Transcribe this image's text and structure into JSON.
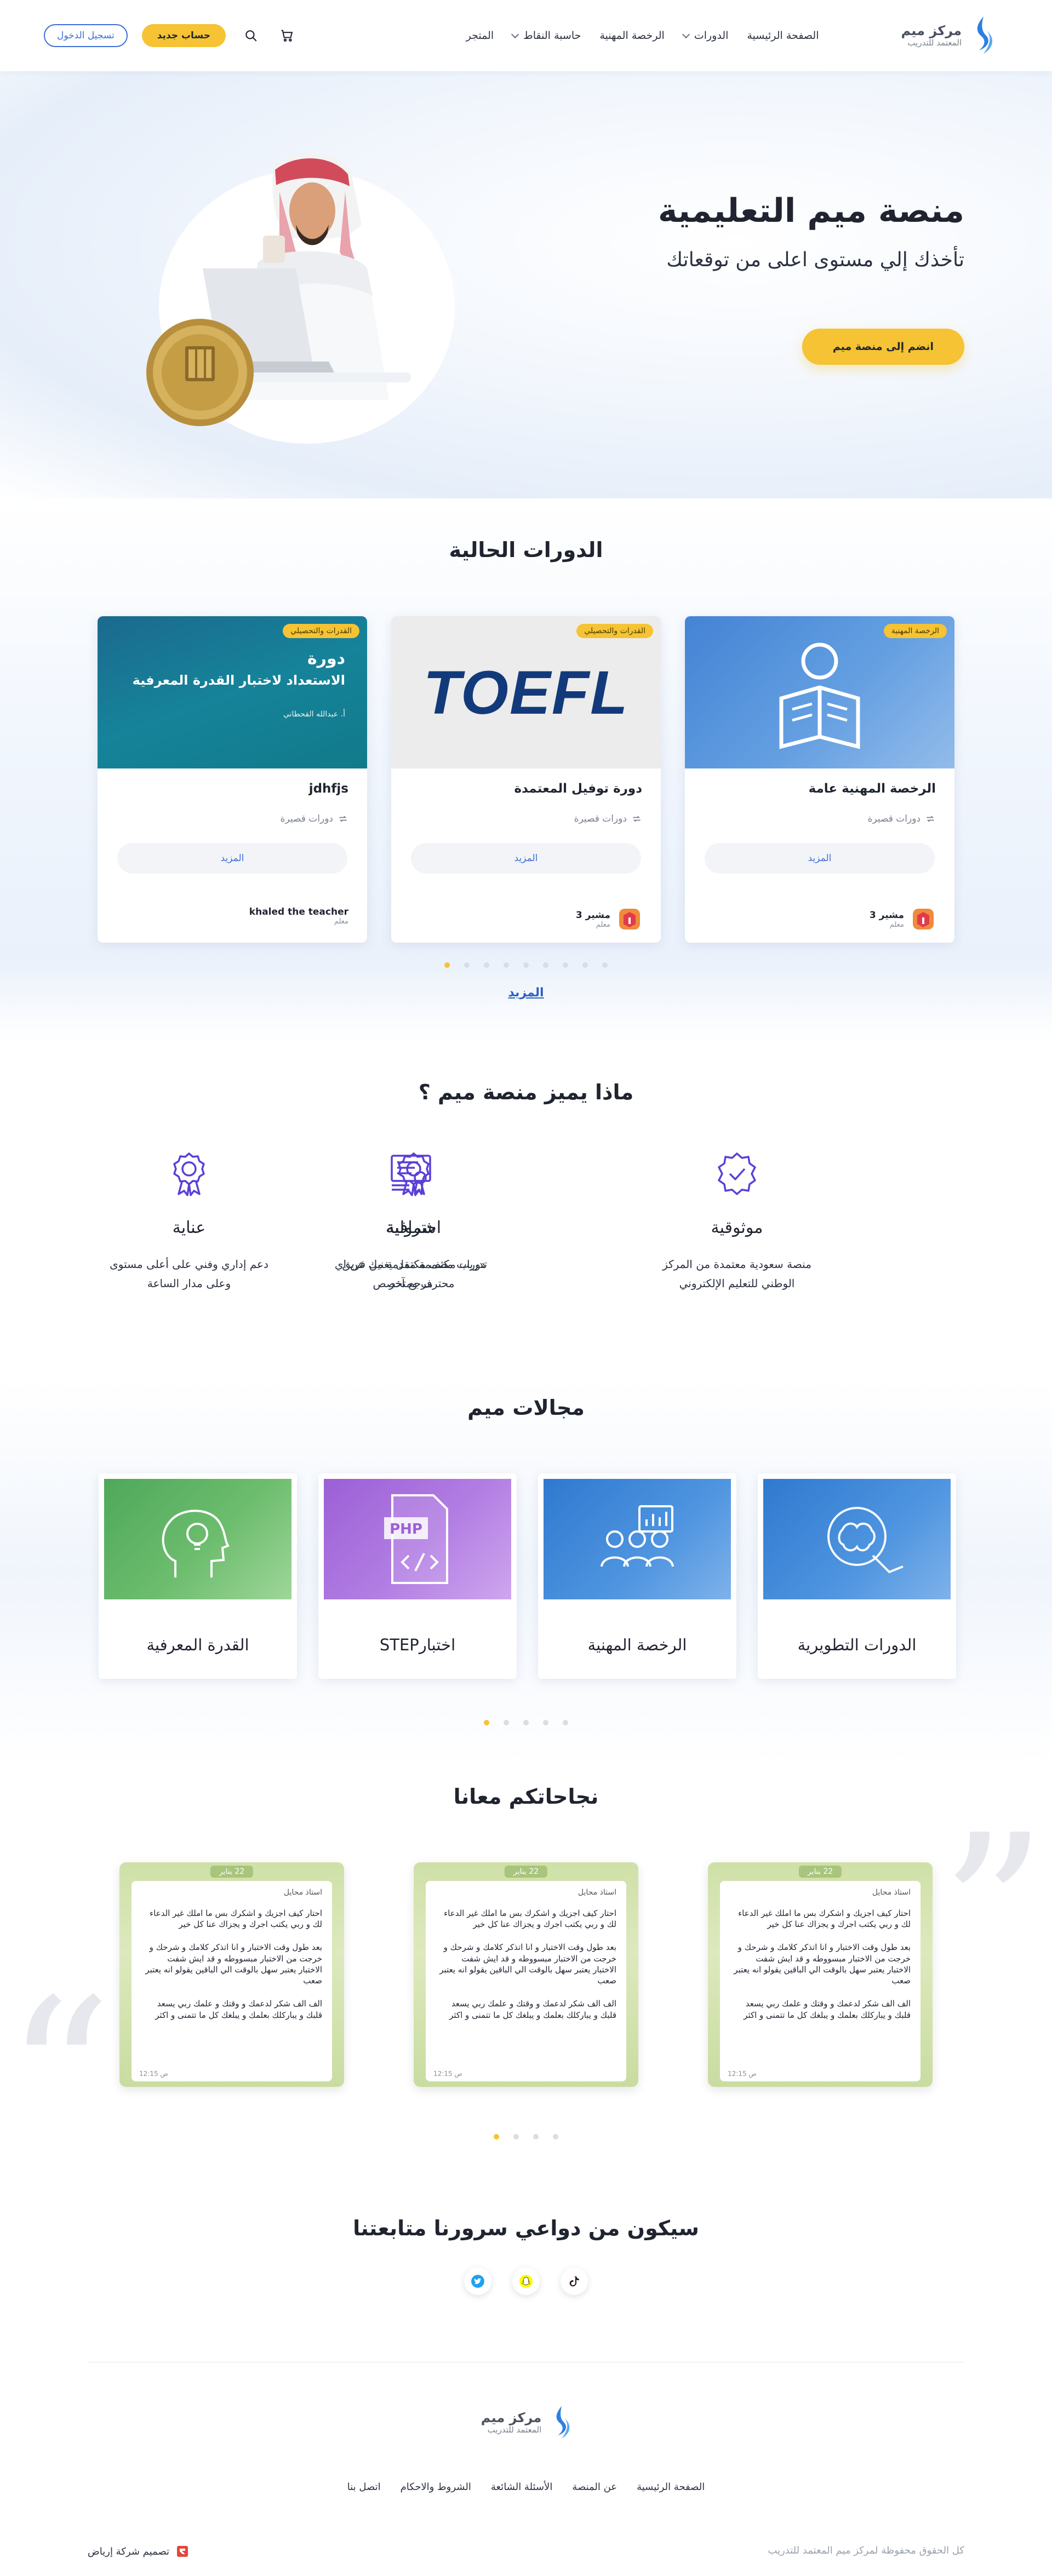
{
  "header": {
    "logo_title": "مركز ميم",
    "logo_subtitle": "المعتمد للتدريب",
    "nav": [
      {
        "label": "الصفحة الرئيسية",
        "has_dropdown": false
      },
      {
        "label": "الدورات",
        "has_dropdown": true
      },
      {
        "label": "الرخصة المهنية",
        "has_dropdown": false
      },
      {
        "label": "حاسبة النقاط",
        "has_dropdown": true
      },
      {
        "label": "المتجر",
        "has_dropdown": false
      }
    ],
    "new_account": "حساب جديد",
    "login": "تسجيل الدخول"
  },
  "hero": {
    "title": "منصة ميم التعليمية",
    "subtitle": "تأخذك إلي مستوى اعلى من توقعاتك",
    "cta": "انضم إلى منصة ميم"
  },
  "courses": {
    "title": "الدورات الحالية",
    "more_label": "المزيد",
    "view_all": "المزيد",
    "items": [
      {
        "badge": "الرخصة المهنية",
        "title": "الرخصة المهنية عامة",
        "meta": "دورات قصيرة",
        "teacher": "مشير 3",
        "role": "معلم"
      },
      {
        "badge": "القدرات والتحصيلي",
        "title": "دورة توفيل المعتمدة",
        "meta": "دورات قصيرة",
        "teacher": "مشير 3",
        "role": "معلم",
        "thumb_text": "TOEFL"
      },
      {
        "badge": "القدرات والتحصيلي",
        "title": "jdhfjs",
        "meta": "دورات قصيرة",
        "teacher": "khaled the teacher",
        "role": "معلم",
        "thumb_line1": "دورة",
        "thumb_line2": "الاستعداد لاختبار القدرة المعرفية",
        "thumb_author": "أ. عبدالله القحطاني"
      }
    ],
    "dot_count": 9
  },
  "features": {
    "title": "ماذا يميز منصة ميم ؟",
    "items": [
      {
        "title": "موثوقية",
        "desc": "منصة سعودية معتمدة من المركز الوطني للتعليم الإلكتروني",
        "icon": "shield-check-icon"
      },
      {
        "title": "احترافية",
        "desc": "دورات مصممة مقدمة من فريق محترف ومتخصص",
        "icon": "award-ribbon-icon"
      },
      {
        "title": "شمولية",
        "desc": "تدريب مكثف مكتمل يغنيك عن اي مرجع آخر",
        "icon": "certificate-icon"
      },
      {
        "title": "عناية",
        "desc": "دعم إداري وفني على أعلى مستوى وعلى مدار الساعة",
        "icon": "award-ribbon-icon"
      }
    ]
  },
  "fields": {
    "title": "مجالات ميم",
    "items": [
      {
        "label": "الدورات التطويرية"
      },
      {
        "label": "الرخصة المهنية"
      },
      {
        "label": "اختبارSTEP"
      },
      {
        "label": "القدرة المعرفية"
      }
    ],
    "dot_count": 5
  },
  "testimonials": {
    "title": "نجاحاتكم معانا",
    "items": [
      {
        "date": "22 يناير",
        "name": "استاذ محايل",
        "p1": "احتار كيف اجزيك و اشكرك بس ما املك غير الدعاء لك و ربي يكتب اجرك و يجزاك عنا كل خير",
        "p2": "بعد طول وقت الاختبار و انا اتذكر كلامك و شرحك و خرجت من الاختبار مبسووطه و قد ايش شفت الاختبار يعتبر سهل بالوقت الي الباقين يقولو انه يعتبر صعب",
        "p3": "الف الف شكر لدعمك و وقتك و علمك ربي يسعد قلبك و يباركلك بعلمك و يبلغك كل ما تتمنى و اكثر",
        "time": "12:15 ص"
      },
      {
        "date": "22 يناير",
        "name": "استاذ محايل",
        "p1": "احتار كيف اجزيك و اشكرك بس ما املك غير الدعاء لك و ربي يكتب اجرك و يجزاك عنا كل خير",
        "p2": "بعد طول وقت الاختبار و انا اتذكر كلامك و شرحك و خرجت من الاختبار مبسووطه و قد ايش شفت الاختبار يعتبر سهل بالوقت الي الباقين يقولو انه يعتبر صعب",
        "p3": "الف الف شكر لدعمك و وقتك و علمك ربي يسعد قلبك و يباركلك بعلمك و يبلغك كل ما تتمنى و اكثر",
        "time": "12:15 ص"
      },
      {
        "date": "22 يناير",
        "name": "استاذ محايل",
        "p1": "احتار كيف اجزيك و اشكرك بس ما املك غير الدعاء لك و ربي يكتب اجرك و يجزاك عنا كل خير",
        "p2": "بعد طول وقت الاختبار و انا اتذكر كلامك و شرحك و خرجت من الاختبار مبسووطه و قد ايش شفت الاختبار يعتبر سهل بالوقت الي الباقين يقولو انه يعتبر صعب",
        "p3": "الف الف شكر لدعمك و وقتك و علمك ربي يسعد قلبك و يباركلك بعلمك و يبلغك كل ما تتمنى و اكثر",
        "time": "12:15 ص"
      }
    ],
    "dot_count": 4
  },
  "social": {
    "title": "سيكون من دواعي سرورنا متابعتنا",
    "icons": [
      "tiktok-icon",
      "snapchat-icon",
      "twitter-icon"
    ]
  },
  "footer": {
    "links": [
      "الصفحة الرئيسية",
      "عن المنصة",
      "الأسئلة الشائعة",
      "الشروط والاحكام",
      "اتصل بنا"
    ],
    "copyright": "كل الحقوق محفوظة لمركز ميم المعتمد للتدريب",
    "credit": "تصميم شركة إرياض"
  },
  "colors": {
    "accent": "#f5c333",
    "primary_blue": "#2f6fd8",
    "link_blue": "#3d6fd6",
    "text": "#1f2430"
  }
}
